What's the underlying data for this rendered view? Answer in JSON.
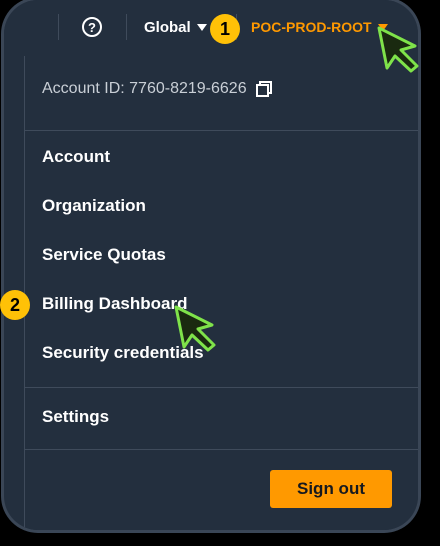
{
  "topbar": {
    "help_glyph": "?",
    "region_label": "Global",
    "account_name": "POC-PROD-ROOT"
  },
  "menu": {
    "account_id": "Account ID: 7760-8219-6626",
    "items": [
      {
        "label": "Account"
      },
      {
        "label": "Organization"
      },
      {
        "label": "Service Quotas"
      },
      {
        "label": "Billing Dashboard"
      },
      {
        "label": "Security credentials"
      },
      {
        "label": "Settings"
      }
    ],
    "sign_out_label": "Sign out"
  },
  "annotations": {
    "step_1": "1",
    "step_2": "2"
  },
  "icons": [
    "help-icon",
    "chevron-down-icon",
    "copy-icon",
    "cursor-icon"
  ],
  "colors": {
    "background": "#232f3e",
    "accent": "#ff9900",
    "text": "#ffffff",
    "muted_text": "#c9cfd6",
    "badge": "#ffc107",
    "cursor_glow": "#7fe34a"
  }
}
